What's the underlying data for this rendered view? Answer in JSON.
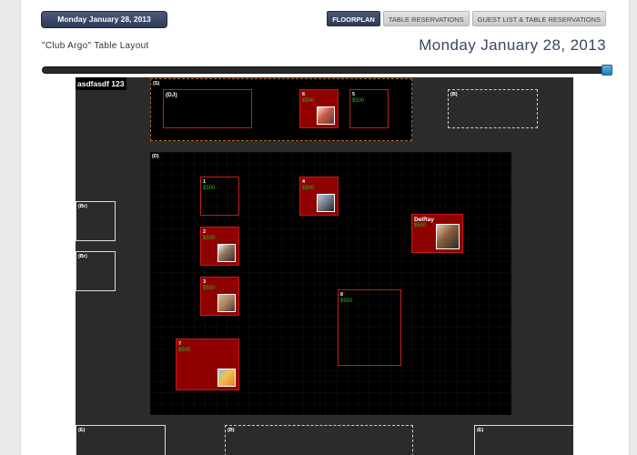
{
  "header": {
    "date_button": "Monday January 28, 2013",
    "tabs": [
      {
        "label": "FLOORPLAN",
        "active": true
      },
      {
        "label": "TABLE RESERVATIONS",
        "active": false
      },
      {
        "label": "GUEST LIST & TABLE RESERVATIONS",
        "active": false
      }
    ],
    "venue_title": "\"Club Argo\" Table Layout",
    "date_heading": "Monday January 28, 2013"
  },
  "slider": {
    "value_fraction": 1.0
  },
  "floorplan": {
    "name": "asdfasdf 123",
    "zones": {
      "s": "(S)",
      "d": "(D)",
      "b_top": "(B)",
      "b_bottom": "(B)",
      "br_1": "(Br)",
      "br_2": "(Br)",
      "e_left": "(E)",
      "e_right": "(E)"
    },
    "tables": {
      "dj": {
        "label": "(DJ)"
      },
      "t6": {
        "number": "6",
        "price": "$500"
      },
      "t5": {
        "number": "5",
        "price": "$500"
      },
      "t1": {
        "number": "1",
        "price": "$500"
      },
      "t4": {
        "number": "4",
        "price": "$500"
      },
      "t2": {
        "number": "2",
        "price": "$500"
      },
      "t3": {
        "number": "3",
        "price": "$500"
      },
      "delray": {
        "label": "DelRay",
        "price": "$500"
      },
      "t8": {
        "number": "8",
        "price": "$500"
      },
      "t7": {
        "number": "7",
        "price": "$500"
      }
    }
  },
  "colors": {
    "accent_navy": "#3a4666",
    "table_border": "#c21b1b",
    "table_fill": "#8f0000",
    "price_green": "#1fbf1f",
    "slider_handle": "#2f93c8"
  }
}
